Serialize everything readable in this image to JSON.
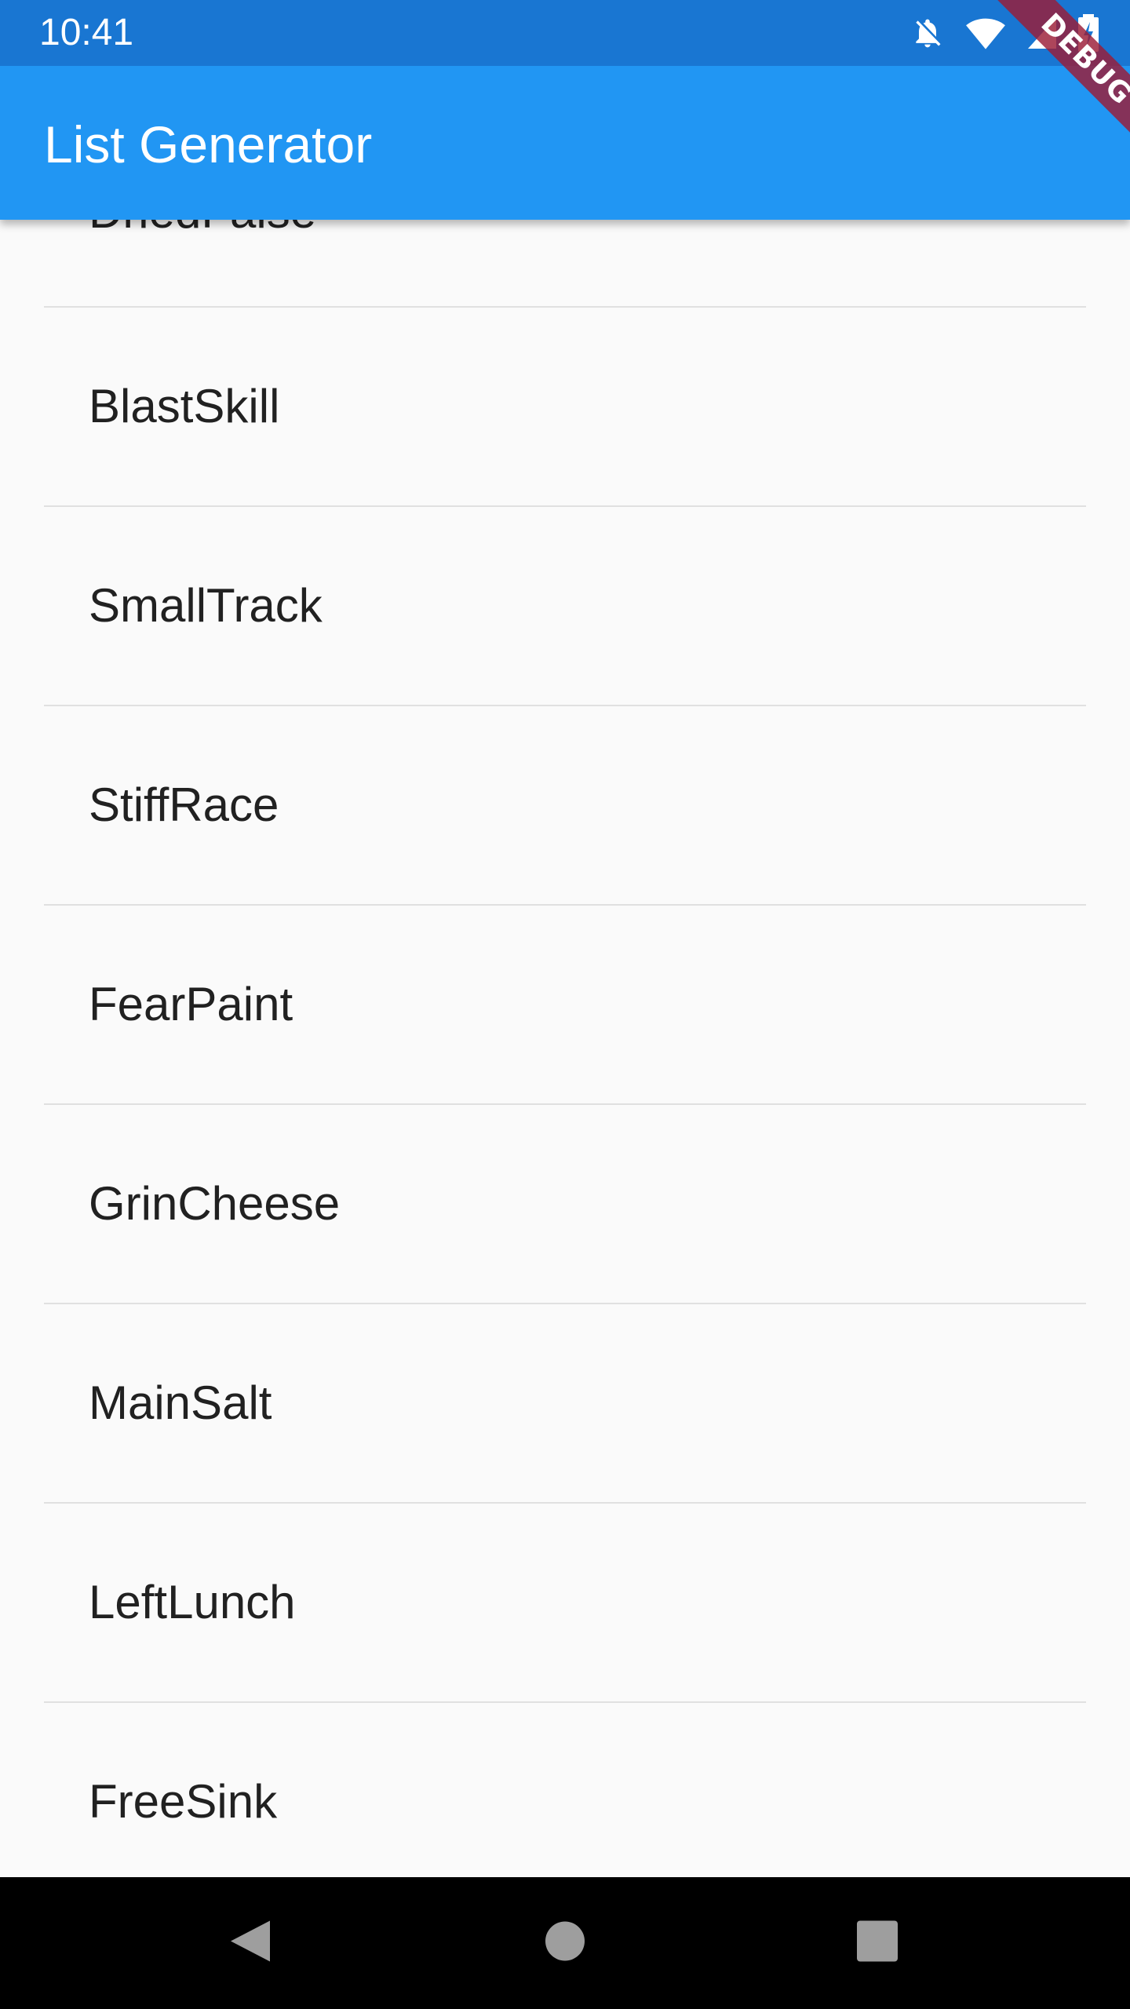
{
  "status_bar": {
    "time": "10:41",
    "icons": [
      "notifications-off-icon",
      "wifi-icon",
      "cell-signal-icon",
      "battery-charging-icon"
    ]
  },
  "app_bar": {
    "title": "List Generator"
  },
  "debug_banner": {
    "label": "DEBUG"
  },
  "list": {
    "items": [
      {
        "label": "DriedFalse"
      },
      {
        "label": "BlastSkill"
      },
      {
        "label": "SmallTrack"
      },
      {
        "label": "StiffRace"
      },
      {
        "label": "FearPaint"
      },
      {
        "label": "GrinCheese"
      },
      {
        "label": "MainSalt"
      },
      {
        "label": "LeftLunch"
      },
      {
        "label": "FreeSink"
      }
    ]
  },
  "nav_bar": {
    "buttons": [
      "back-icon",
      "home-icon",
      "recents-icon"
    ]
  },
  "colors": {
    "status_bar": "#1976d2",
    "app_bar": "#2196f3",
    "background": "#fafafa",
    "divider": "#e0e0e0",
    "text": "#212121",
    "debug_ribbon": "#9b1c37"
  }
}
